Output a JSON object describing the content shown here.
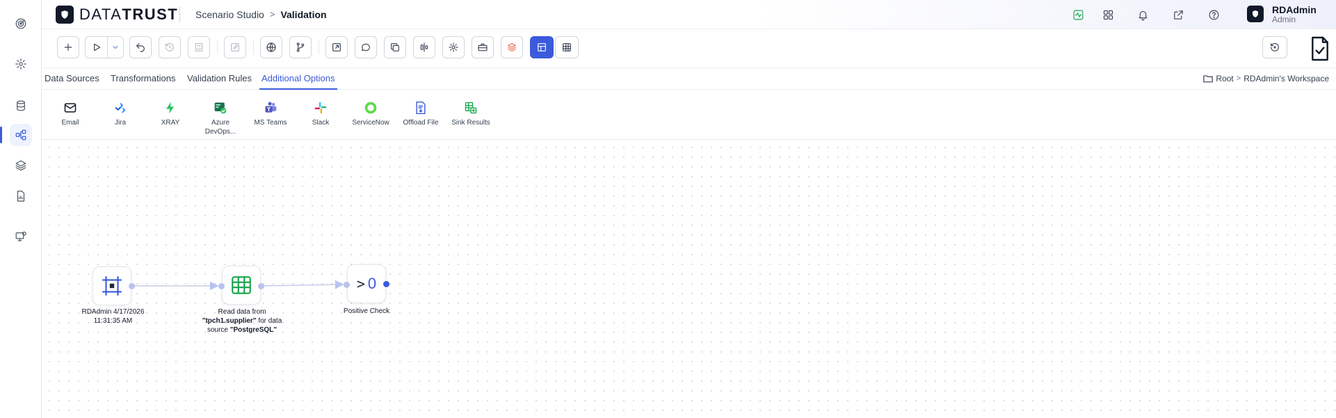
{
  "brand": {
    "part1": "DATA",
    "part2": "TRUST"
  },
  "breadcrumb": {
    "parent": "Scenario Studio",
    "separator": ">",
    "current": "Validation"
  },
  "user": {
    "name": "RDAdmin",
    "role": "Admin"
  },
  "header_icons": [
    "activity-icon",
    "grid-icon",
    "bell-icon",
    "external-link-icon",
    "help-icon"
  ],
  "rail_icons": [
    "target-icon",
    "settings-icon",
    "database-icon",
    "flow-icon",
    "layers-icon",
    "report-icon",
    "monitor-icon"
  ],
  "tabs": [
    {
      "label": "Data Sources"
    },
    {
      "label": "Transformations"
    },
    {
      "label": "Validation Rules"
    },
    {
      "label": "Additional Options",
      "active": true
    }
  ],
  "workspace": {
    "root": "Root",
    "separator": ">",
    "name": "RDAdmin's Workspace"
  },
  "palette": [
    {
      "label": "Email",
      "icon": "email-icon"
    },
    {
      "label": "Jira",
      "icon": "jira-icon"
    },
    {
      "label": "XRAY",
      "icon": "xray-icon"
    },
    {
      "label": "Azure DevOps...",
      "icon": "azure-devops-icon"
    },
    {
      "label": "MS Teams",
      "icon": "ms-teams-icon"
    },
    {
      "label": "Slack",
      "icon": "slack-icon"
    },
    {
      "label": "ServiceNow",
      "icon": "servicenow-icon"
    },
    {
      "label": "Offload File",
      "icon": "offload-file-icon"
    },
    {
      "label": "Sink Results",
      "icon": "sink-results-icon"
    }
  ],
  "nodes": {
    "start": {
      "label": "RDAdmin 4/17/2026 11:31:35 AM"
    },
    "read": {
      "label_pre": "Read data from ",
      "table": "\"tpch1.supplier\"",
      "label_mid": " for data source ",
      "source": "\"PostgreSQL\""
    },
    "check": {
      "symbol": ">",
      "value": "0",
      "label": "Positive Check"
    }
  },
  "colors": {
    "accent": "#3b5bdb",
    "green": "#16a34a"
  }
}
